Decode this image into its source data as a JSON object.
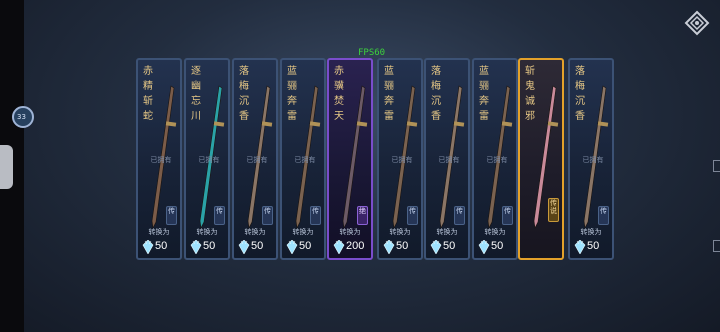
{
  "overlay": {
    "fps": "FPS60",
    "float_ball": "33"
  },
  "cards": [
    {
      "name": [
        "赤",
        "精",
        "斩",
        "蛇"
      ],
      "owned": "已拥有",
      "grade": "传",
      "convert": "转换为",
      "amount": "50",
      "rarity": "blue",
      "blade": "#7b5c49"
    },
    {
      "name": [
        "逐",
        "幽",
        "忘",
        "川"
      ],
      "owned": "已拥有",
      "grade": "传",
      "convert": "转换为",
      "amount": "50",
      "rarity": "blue",
      "blade": "#2aa2a7"
    },
    {
      "name": [
        "落",
        "梅",
        "沉",
        "香"
      ],
      "owned": "已拥有",
      "grade": "传",
      "convert": "转换为",
      "amount": "50",
      "rarity": "blue",
      "blade": "#8a7566"
    },
    {
      "name": [
        "蓝",
        "骊",
        "奔",
        "雷"
      ],
      "owned": "已拥有",
      "grade": "传",
      "convert": "转换为",
      "amount": "50",
      "rarity": "blue",
      "blade": "#7a6250"
    },
    {
      "name": [
        "赤",
        "骥",
        "焚",
        "天"
      ],
      "owned": "",
      "grade": "绝",
      "convert": "转换为",
      "amount": "200",
      "rarity": "purple",
      "blade": "#6c5a66"
    },
    {
      "name": [
        "蓝",
        "骊",
        "奔",
        "雷"
      ],
      "owned": "已拥有",
      "grade": "传",
      "convert": "转换为",
      "amount": "50",
      "rarity": "blue",
      "blade": "#7a6250"
    },
    {
      "name": [
        "落",
        "梅",
        "沉",
        "香"
      ],
      "owned": "已拥有",
      "grade": "传",
      "convert": "转换为",
      "amount": "50",
      "rarity": "blue",
      "blade": "#8a7566"
    },
    {
      "name": [
        "蓝",
        "骊",
        "奔",
        "雷"
      ],
      "owned": "已拥有",
      "grade": "传",
      "convert": "转换为",
      "amount": "50",
      "rarity": "blue",
      "blade": "#7a6250"
    },
    {
      "name": [
        "斩",
        "鬼",
        "诚",
        "邪"
      ],
      "owned": "",
      "grade": "传说",
      "convert": "",
      "amount": "",
      "rarity": "gold",
      "blade": "#c98a9a"
    },
    {
      "name": [
        "落",
        "梅",
        "沉",
        "香"
      ],
      "owned": "已拥有",
      "grade": "传",
      "convert": "转换为",
      "amount": "50",
      "rarity": "blue",
      "blade": "#8a7566"
    }
  ],
  "colors": {
    "gem": "#9fe3ff",
    "gold_border": "#e3a12a",
    "purple_border": "#7a4dcc",
    "blue_border": "#3c5275"
  }
}
